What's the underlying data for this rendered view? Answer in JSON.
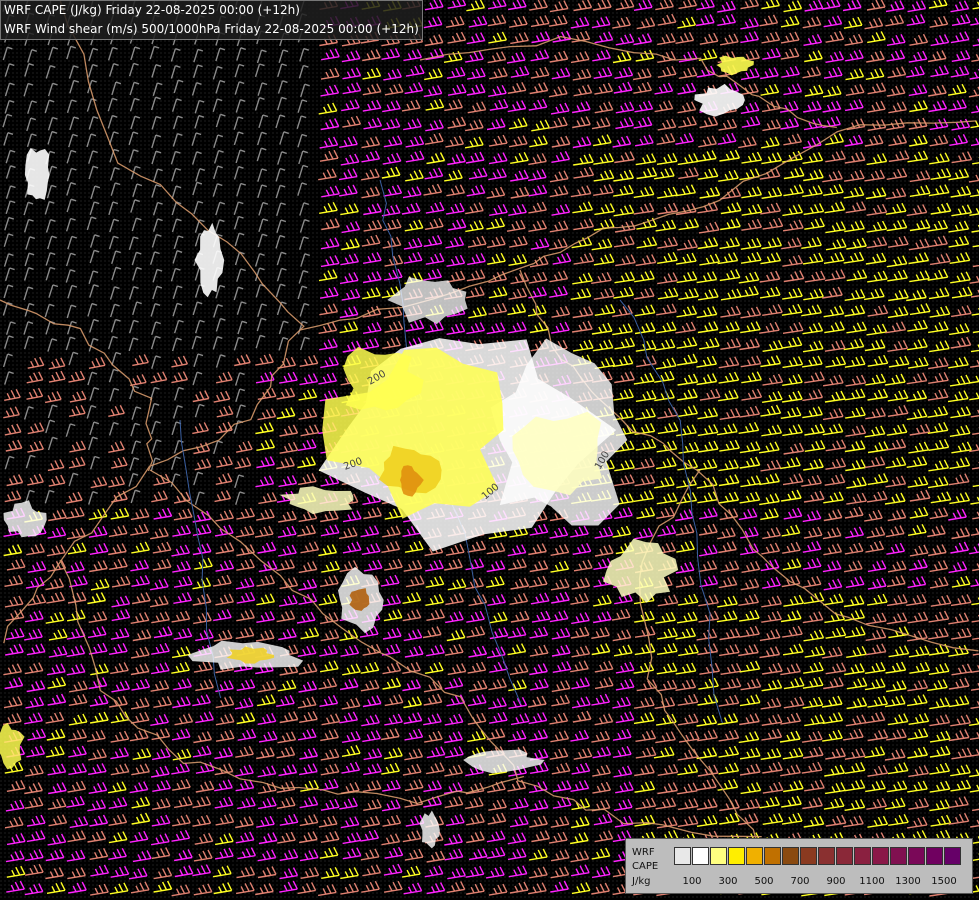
{
  "title": {
    "line1": "WRF CAPE (J/kg) Friday 22-08-2025 00:00 (+12h)",
    "line2": "WRF Wind shear (m/s) 500/1000hPa Friday 22-08-2025 00:00 (+12h)"
  },
  "map": {
    "contour_labels": [
      "200",
      "100",
      "100",
      "200"
    ],
    "colors": {
      "background": "#000000",
      "borders": "#e0a070",
      "rivers": "#3a5fa0",
      "barb_low": "#8a8a8a",
      "barb_mid": "#e08070",
      "barb_high": "#ff22ff",
      "barb_max": "#ffff22",
      "cape_colors": [
        "#ffffff",
        "#ffffc0",
        "#ffff50",
        "#f0d020",
        "#e09010",
        "#b06010"
      ]
    }
  },
  "legend": {
    "label_top": "WRF",
    "label_mid": "CAPE",
    "label_unit": "J/kg",
    "swatches": [
      "#e8e8e8",
      "#ffffff",
      "#ffff80",
      "#ffee00",
      "#f0b000",
      "#c07000",
      "#8a4a10",
      "#8a3a20",
      "#8a3030",
      "#8a2838",
      "#8a2040",
      "#8a1848",
      "#801050",
      "#7a0858",
      "#700060",
      "#660068"
    ],
    "ticks": [
      "100",
      "300",
      "500",
      "700",
      "900",
      "1100",
      "1300",
      "1500"
    ]
  }
}
